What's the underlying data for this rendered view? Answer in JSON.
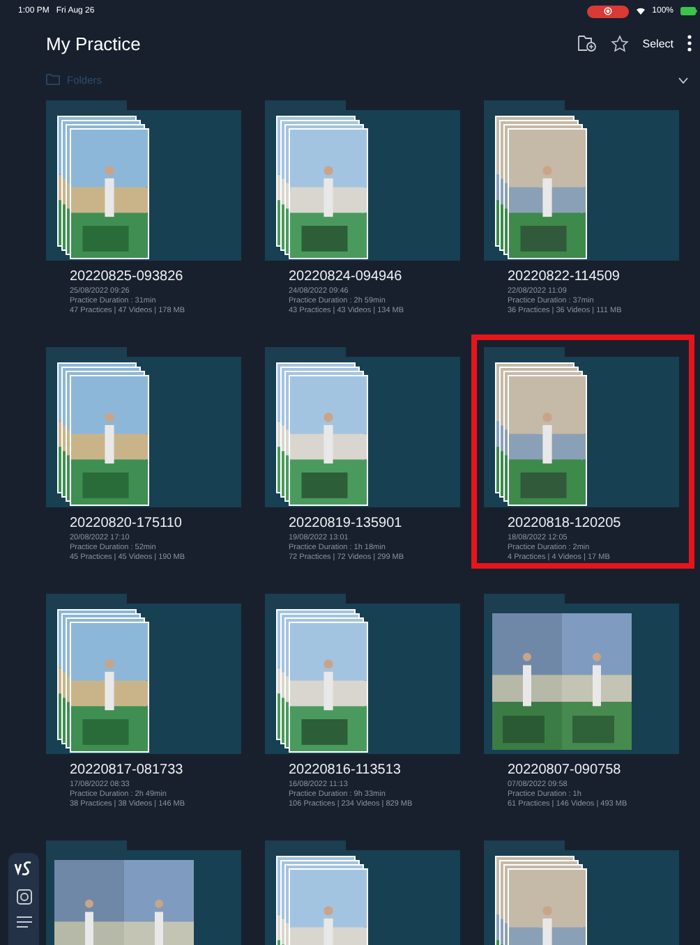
{
  "status_bar": {
    "time": "1:00 PM",
    "date": "Fri Aug 26",
    "recording": true,
    "battery": "100%"
  },
  "header": {
    "title": "My Practice",
    "select": "Select"
  },
  "folders_bar": {
    "label": "Folders",
    "expanded": false
  },
  "folders": [
    {
      "kind": "stack",
      "name": "20220825-093826",
      "date": "25/08/2022 09:26",
      "duration": "Practice Duration : 31min",
      "counts": "47 Practices | 47 Videos | 178 MB",
      "highlighted": false
    },
    {
      "kind": "stack",
      "name": "20220824-094946",
      "date": "24/08/2022 09:46",
      "duration": "Practice Duration : 2h 59min",
      "counts": "43 Practices | 43 Videos | 134 MB",
      "highlighted": false
    },
    {
      "kind": "stack",
      "name": "20220822-114509",
      "date": "22/08/2022 11:09",
      "duration": "Practice Duration : 37min",
      "counts": "36 Practices | 36 Videos | 111 MB",
      "highlighted": false
    },
    {
      "kind": "stack",
      "name": "20220820-175110",
      "date": "20/08/2022 17:10",
      "duration": "Practice Duration : 52min",
      "counts": "45 Practices | 45 Videos | 190 MB",
      "highlighted": false
    },
    {
      "kind": "stack",
      "name": "20220819-135901",
      "date": "19/08/2022 13:01",
      "duration": "Practice Duration : 1h 18min",
      "counts": "72 Practices | 72 Videos | 299 MB",
      "highlighted": false
    },
    {
      "kind": "stack",
      "name": "20220818-120205",
      "date": "18/08/2022 12:05",
      "duration": "Practice Duration : 2min",
      "counts": "4 Practices | 4 Videos | 17 MB",
      "highlighted": true
    },
    {
      "kind": "stack",
      "name": "20220817-081733",
      "date": "17/08/2022 08:33",
      "duration": "Practice Duration : 2h 49min",
      "counts": "38 Practices | 38 Videos | 146 MB",
      "highlighted": false
    },
    {
      "kind": "stack",
      "name": "20220816-113513",
      "date": "16/08/2022 11:13",
      "duration": "Practice Duration : 9h 33min",
      "counts": "106 Practices | 234 Videos | 829 MB",
      "highlighted": false
    },
    {
      "kind": "split",
      "name": "20220807-090758",
      "date": "07/08/2022 09:58",
      "duration": "Practice Duration : 1h",
      "counts": "61 Practices | 146 Videos | 493 MB",
      "highlighted": false
    },
    {
      "kind": "split",
      "highlighted": false
    },
    {
      "kind": "stack",
      "highlighted": false
    },
    {
      "kind": "stack",
      "highlighted": false
    }
  ]
}
